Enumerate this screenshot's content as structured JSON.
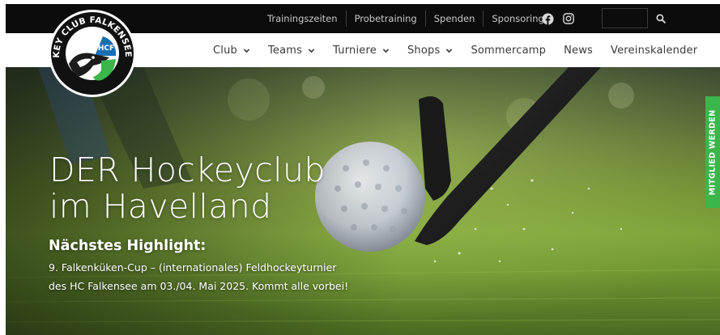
{
  "colors": {
    "topbar_bg": "#0c0c0c",
    "nav_text": "#3a3a3a",
    "accent_green": "#3cb54a",
    "logo_blue": "#1a6fb4"
  },
  "topbar": {
    "links": [
      {
        "label": "Trainingszeiten"
      },
      {
        "label": "Probetraining"
      },
      {
        "label": "Spenden"
      },
      {
        "label": "Sponsoring"
      }
    ],
    "social_icons": [
      "facebook-icon",
      "instagram-icon"
    ],
    "search": {
      "placeholder": "",
      "icon": "search-icon"
    }
  },
  "logo": {
    "arc_text": "HOCKEY CLUB FALKENSEE e.V.",
    "badge": "HCF"
  },
  "nav": {
    "items": [
      {
        "label": "Club",
        "has_dropdown": true
      },
      {
        "label": "Teams",
        "has_dropdown": true
      },
      {
        "label": "Turniere",
        "has_dropdown": true
      },
      {
        "label": "Shops",
        "has_dropdown": true
      },
      {
        "label": "Sommercamp",
        "has_dropdown": false
      },
      {
        "label": "News",
        "has_dropdown": false
      },
      {
        "label": "Vereinskalender",
        "has_dropdown": false
      }
    ]
  },
  "hero": {
    "title_line1": "DER Hockeyclub",
    "title_line2": "im Havelland",
    "subtitle": "Nächstes Highlight:",
    "text_line1": "9. Falkenküken-Cup – (internationales) Feldhockeyturnier",
    "text_line2": "des HC Falkensee am 03./04. Mai 2025. Kommt alle vorbei!"
  },
  "sidetab": {
    "label": "MITGLIED WERDEN"
  }
}
